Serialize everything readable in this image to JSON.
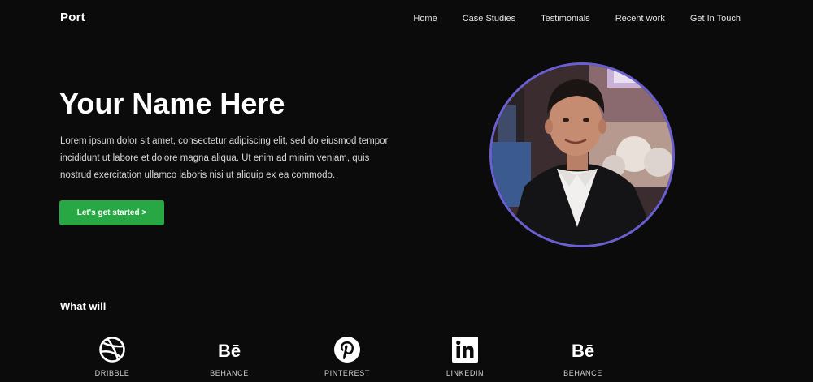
{
  "header": {
    "logo": "Port",
    "nav": [
      "Home",
      "Case Studies",
      "Testimonials",
      "Recent work",
      "Get In Touch"
    ]
  },
  "hero": {
    "title": "Your Name Here",
    "description": "Lorem ipsum dolor sit amet, consectetur adipiscing elit, sed do eiusmod tempor incididunt ut labore et dolore magna aliqua. Ut enim ad minim veniam, quis nostrud exercitation ullamco laboris nisi ut aliquip ex ea commodo.",
    "cta_label": "Let's get started >"
  },
  "avatar": {
    "border_color": "#6a5fd0"
  },
  "services": {
    "title": "What will",
    "items": [
      {
        "label": "DRIBBLE",
        "icon": "dribbble-icon"
      },
      {
        "label": "BEHANCE",
        "icon": "behance-icon"
      },
      {
        "label": "PINTEREST",
        "icon": "pinterest-icon"
      },
      {
        "label": "LINKEDIN",
        "icon": "linkedin-icon"
      },
      {
        "label": "BEHANCE",
        "icon": "behance-icon"
      }
    ]
  },
  "colors": {
    "background": "#0b0b0b",
    "accent": "#28a745",
    "text": "#ffffff"
  }
}
